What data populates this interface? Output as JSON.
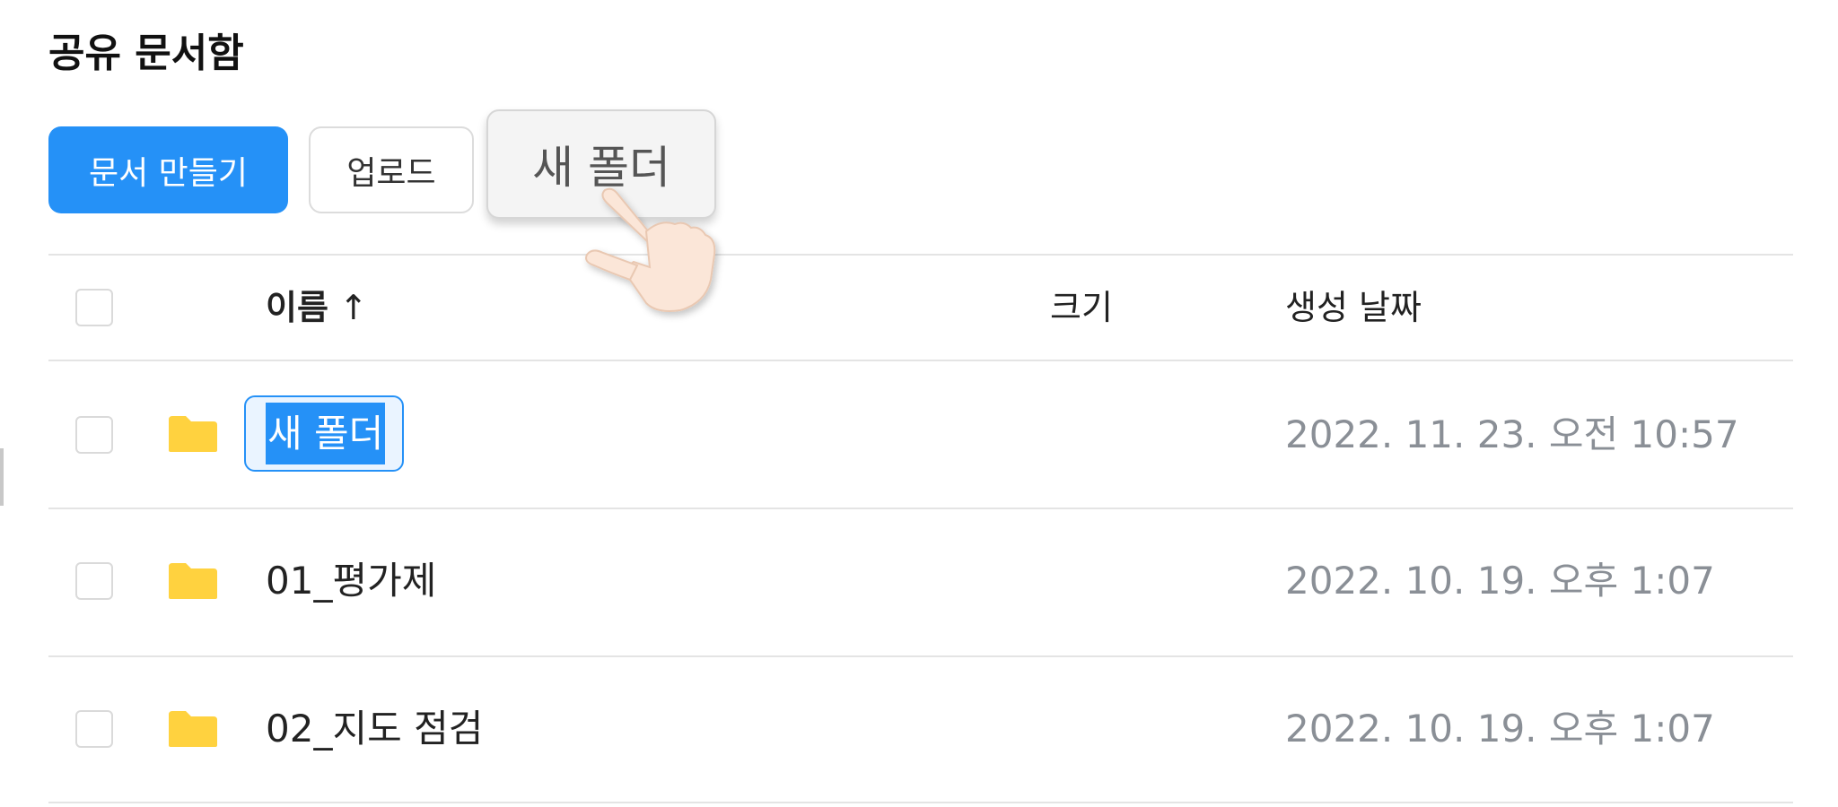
{
  "header": {
    "title": "공유 문서함"
  },
  "toolbar": {
    "create_label": "문서 만들기",
    "upload_label": "업로드",
    "new_folder_label": "새 폴더"
  },
  "table": {
    "columns": {
      "name": "이름",
      "name_sort_indicator": "↑",
      "size": "크기",
      "created": "생성 날짜"
    },
    "rows": [
      {
        "name": "새 폴더",
        "size": "",
        "created": "2022. 11. 23. 오전 10:57",
        "editing": true
      },
      {
        "name": "01_평가제",
        "size": "",
        "created": "2022. 10. 19. 오후 1:07"
      },
      {
        "name": "02_지도 점검",
        "size": "",
        "created": "2022. 10. 19. 오후 1:07"
      }
    ]
  },
  "icons": {
    "folder": "folder-icon",
    "cursor": "hand-pointer-icon"
  },
  "colors": {
    "accent": "#2591f7",
    "folder": "#ffd23f",
    "muted_text": "#8a8f96",
    "divider": "#e4e4e4"
  }
}
